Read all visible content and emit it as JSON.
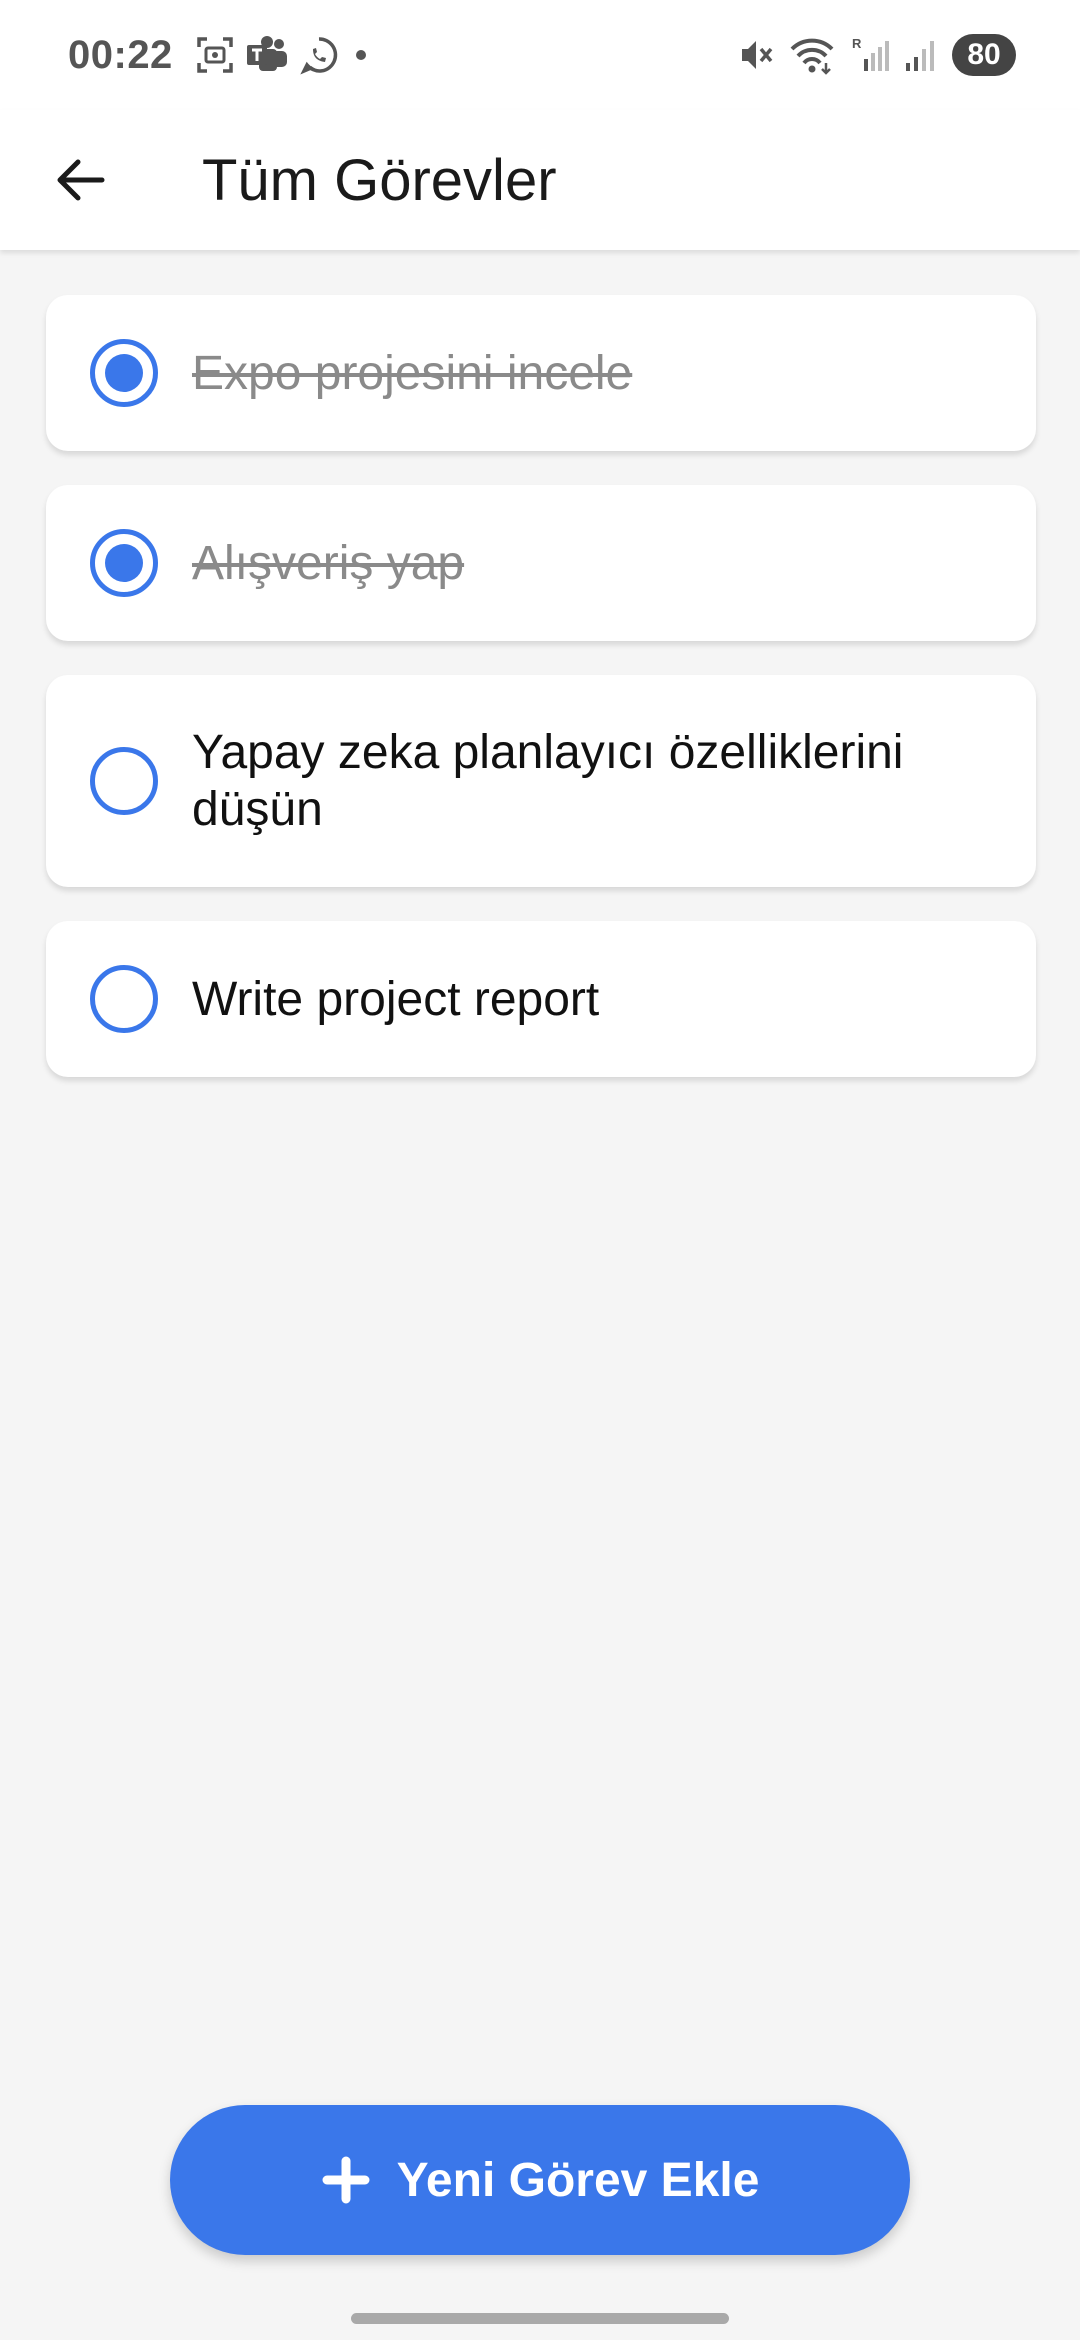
{
  "status_bar": {
    "time": "00:22",
    "battery": "80",
    "left_icons": [
      "screenshot-icon",
      "teams-icon",
      "whatsapp-icon",
      "dot-icon"
    ],
    "right_icons": [
      "mute-icon",
      "wifi-icon",
      "signal-icon",
      "signal-icon"
    ]
  },
  "app_bar": {
    "title": "Tüm Görevler",
    "back_icon": "arrow-left-icon"
  },
  "tasks": [
    {
      "label": "Expo projesini incele",
      "completed": true
    },
    {
      "label": "Alışveriş yap",
      "completed": true
    },
    {
      "label": "Yapay zeka planlayıcı özelliklerini düşün",
      "completed": false
    },
    {
      "label": "Write project report",
      "completed": false
    }
  ],
  "add_button": {
    "label": "Yeni Görev Ekle",
    "icon": "plus-icon"
  },
  "colors": {
    "accent": "#3a77ea",
    "background": "#f5f5f5",
    "card": "#ffffff",
    "completed_text": "#8a8a8a"
  }
}
